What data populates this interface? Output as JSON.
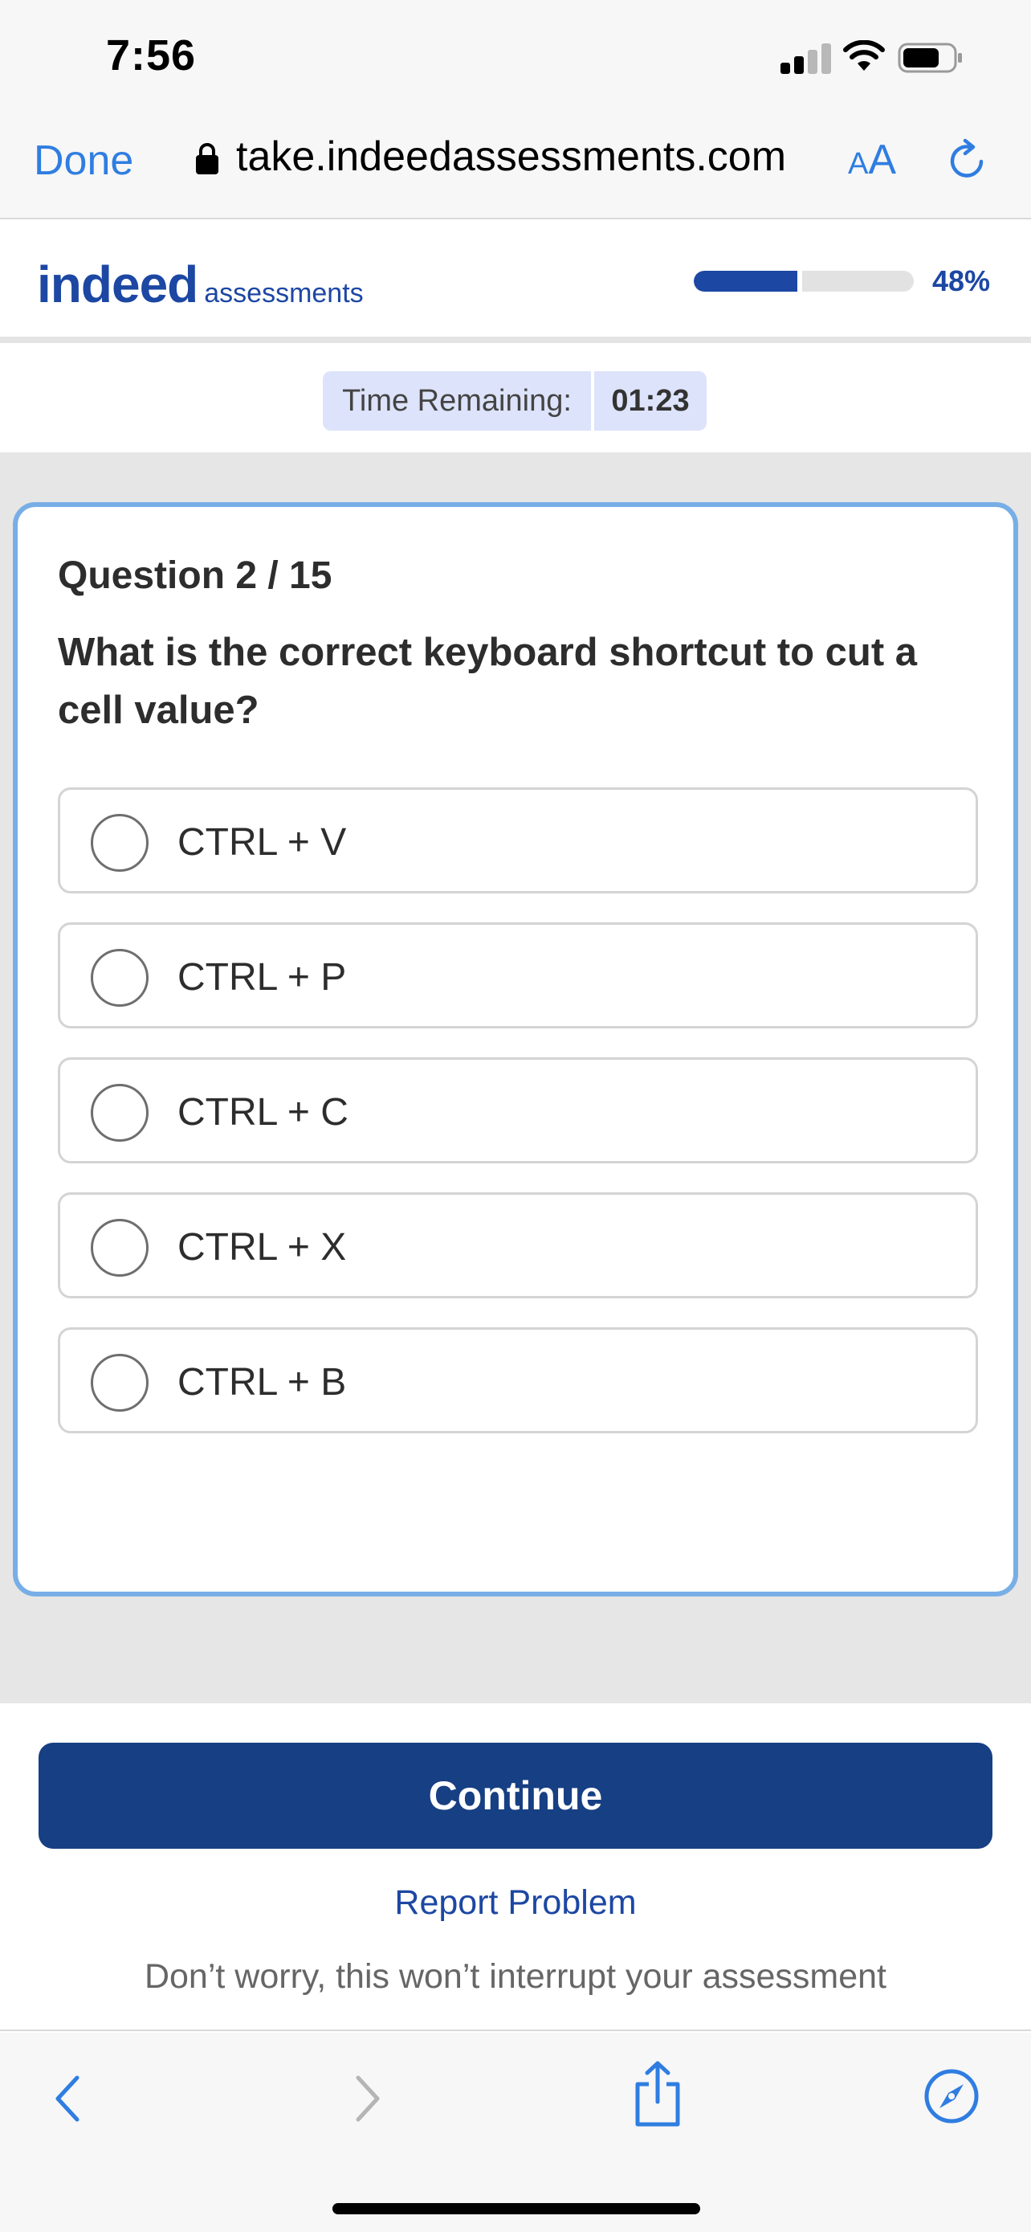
{
  "status_bar": {
    "time": "7:56"
  },
  "browser": {
    "done_label": "Done",
    "url": "take.indeedassessments.com",
    "aa_small": "A",
    "aa_big": "A",
    "accent_color": "#2f7de1"
  },
  "header": {
    "logo_word": "indeed",
    "logo_sub": "assessments",
    "progress_fraction": 0.48,
    "progress_label": "48%",
    "brand_color": "#1c47a3"
  },
  "timer": {
    "label": "Time Remaining:",
    "value": "01:23"
  },
  "question": {
    "number_label": "Question 2 / 15",
    "text": "What is the correct keyboard shortcut to cut a cell value?",
    "options": [
      {
        "label": "CTRL + V",
        "selected": false
      },
      {
        "label": "CTRL + P",
        "selected": false
      },
      {
        "label": "CTRL + C",
        "selected": false
      },
      {
        "label": "CTRL + X",
        "selected": false
      },
      {
        "label": "CTRL + B",
        "selected": false
      }
    ]
  },
  "footer": {
    "continue_label": "Continue",
    "report_label": "Report Problem",
    "reassure_text": "Don’t worry, this won’t interrupt your assessment",
    "button_color": "#173f83"
  },
  "toolbar": {
    "icons": [
      "back-icon",
      "forward-icon",
      "share-icon",
      "compass-icon"
    ]
  }
}
